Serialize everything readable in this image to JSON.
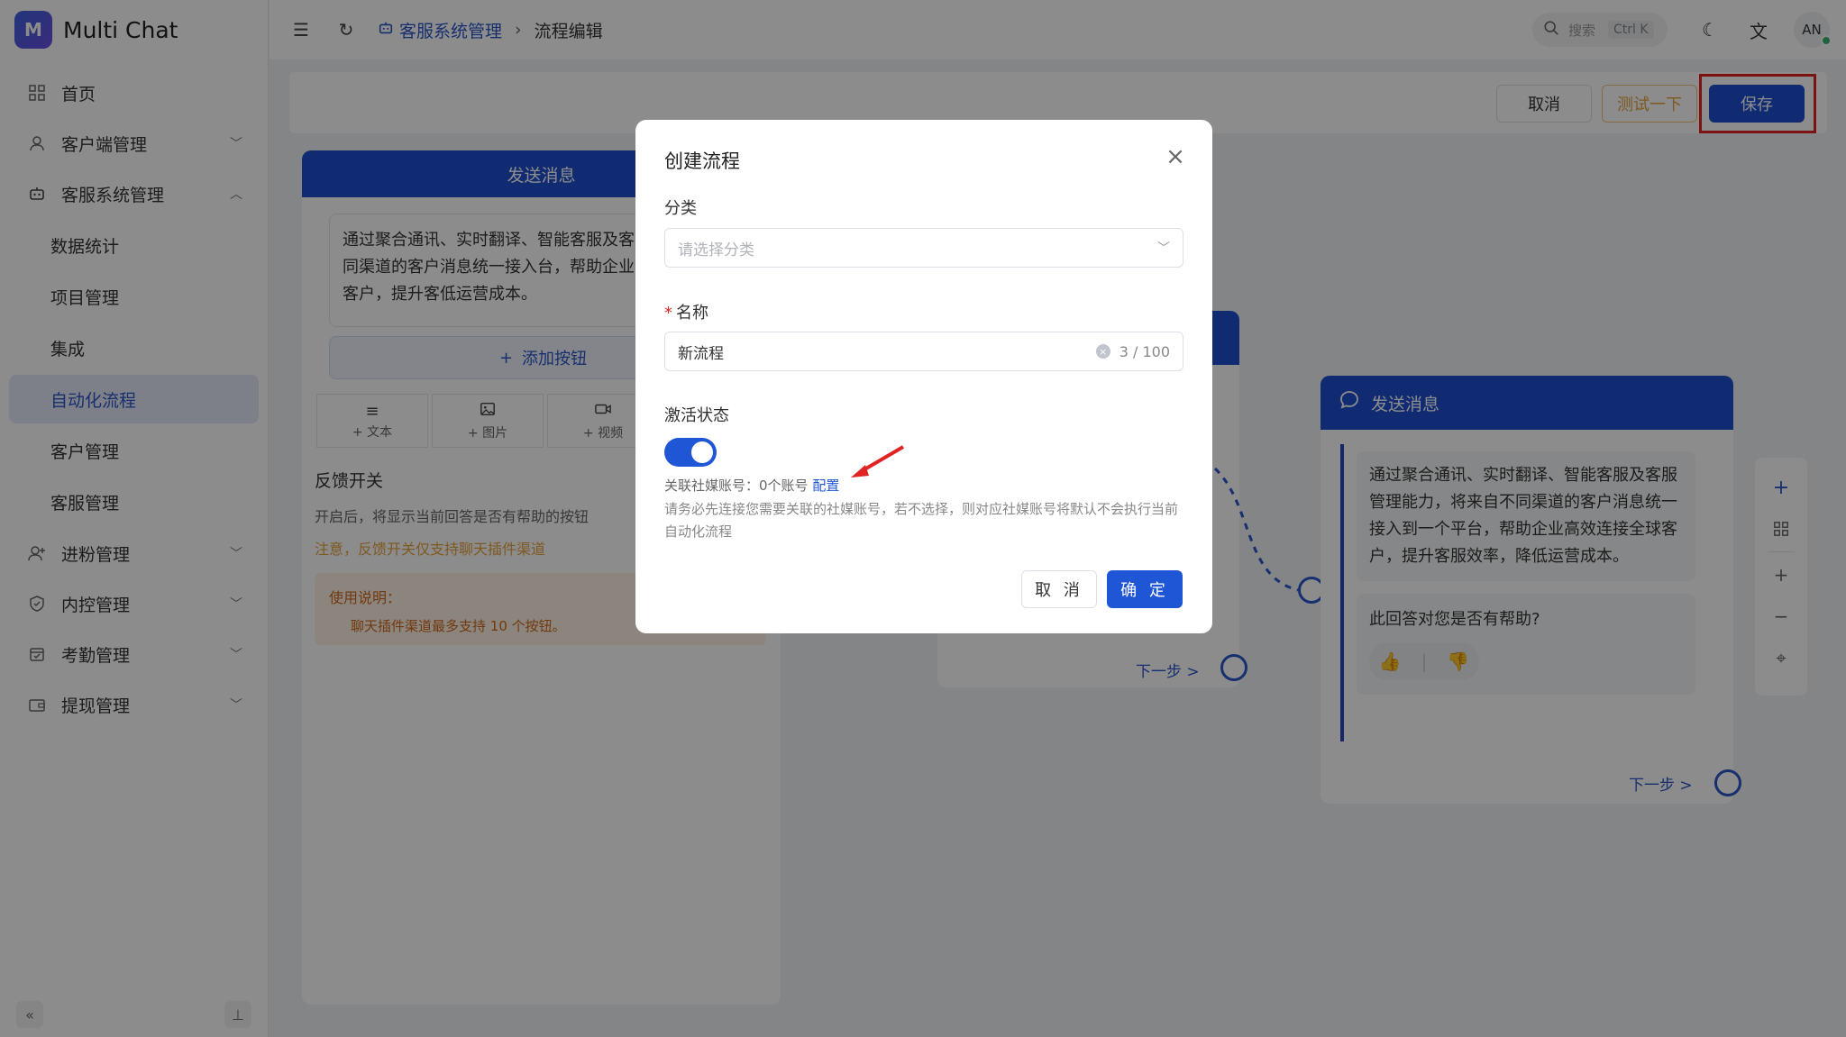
{
  "brand": {
    "name": "Multi Chat",
    "logo_letter": "M"
  },
  "sidebar": {
    "items": [
      {
        "label": "首页",
        "icon": "grid-icon"
      },
      {
        "label": "客户端管理",
        "icon": "user-icon"
      },
      {
        "label": "客服系统管理",
        "icon": "robot-icon"
      },
      {
        "label": "进粉管理",
        "icon": "user-add-icon"
      },
      {
        "label": "内控管理",
        "icon": "shield-icon"
      },
      {
        "label": "考勤管理",
        "icon": "calendar-check-icon"
      },
      {
        "label": "提现管理",
        "icon": "wallet-icon"
      }
    ],
    "sub_items": [
      "数据统计",
      "项目管理",
      "集成",
      "自动化流程",
      "客户管理",
      "客服管理"
    ],
    "active_sub": "自动化流程"
  },
  "topbar": {
    "breadcrumb": [
      "客服系统管理",
      "流程编辑"
    ],
    "search_placeholder": "搜索",
    "search_shortcut": "Ctrl K",
    "avatar_text": "AN"
  },
  "actions": {
    "cancel": "取消",
    "test": "测试一下",
    "save": "保存"
  },
  "left_panel": {
    "header": "发送消息",
    "message": "通过聚合通讯、实时翻译、智能客服及客力，将来自不同渠道的客户消息统一接入台，帮助企业高效连接全球客户，提升客低运营成本。",
    "add_button": "添加按钮",
    "tools": [
      {
        "label": "+ 文本",
        "icon": "text-icon"
      },
      {
        "label": "+ 图片",
        "icon": "image-icon"
      },
      {
        "label": "+ 视频",
        "icon": "video-icon"
      }
    ],
    "feedback_title": "反馈开关",
    "feedback_desc": "开启后，将显示当前回答是否有帮助的按钮",
    "feedback_warn": "注意，反馈开关仅支持聊天插件渠道",
    "usage_title": "使用说明：",
    "usage_item": "聊天插件渠道最多支持 10 个按钮。"
  },
  "mid_node": {
    "next": "下一步 >"
  },
  "right_node": {
    "header": "发送消息",
    "message": "通过聚合通讯、实时翻译、智能客服及客服管理能力，将来自不同渠道的客户消息统一接入到一个平台，帮助企业高效连接全球客户，提升客服效率，降低运营成本。",
    "feedback_question": "此回答对您是否有帮助?",
    "thumbs": [
      "👍",
      "👎"
    ],
    "next": "下一步 >"
  },
  "modal": {
    "title": "创建流程",
    "category_label": "分类",
    "category_placeholder": "请选择分类",
    "name_label": "名称",
    "name_value": "新流程",
    "name_count": "3 / 100",
    "active_label": "激活状态",
    "active": true,
    "account_text": "关联社媒账号：0个账号",
    "account_link": "配置",
    "help": "请务必先连接您需要关联的社媒账号，若不选择，则对应社媒账号将默认不会执行当前自动化流程",
    "cancel": "取 消",
    "ok": "确 定"
  },
  "colors": {
    "primary": "#1f4fd1",
    "accent": "#1f56d6",
    "warn": "#e6a23c",
    "highlight": "#e02424"
  }
}
